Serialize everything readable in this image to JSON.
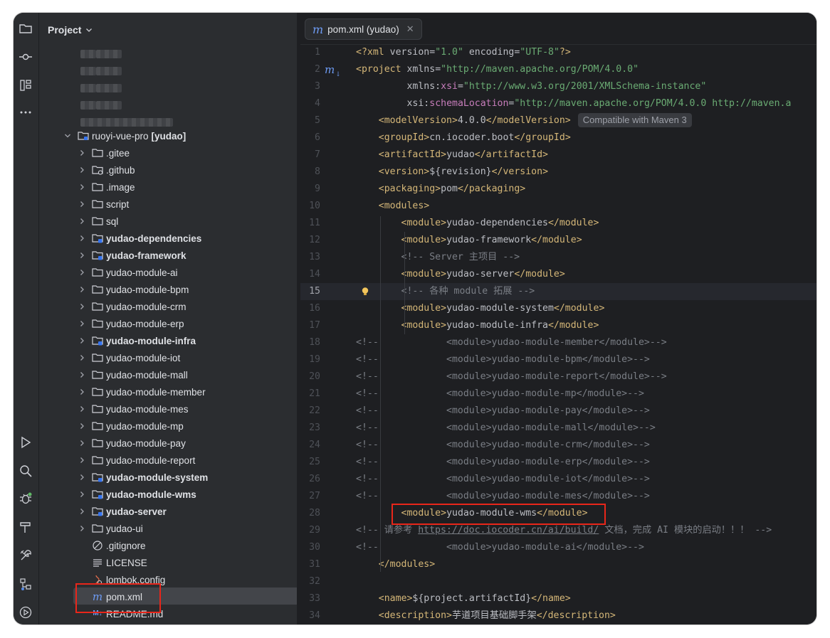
{
  "project_panel": {
    "title": "Project",
    "root": {
      "name": "ruoyi-vue-pro",
      "module": "[yudao]"
    },
    "children": [
      {
        "name": ".gitee",
        "type": "folder",
        "bold": false,
        "expandable": true
      },
      {
        "name": ".github",
        "type": "folder-special",
        "bold": false,
        "expandable": true
      },
      {
        "name": ".image",
        "type": "folder",
        "bold": false,
        "expandable": true
      },
      {
        "name": "script",
        "type": "folder",
        "bold": false,
        "expandable": true
      },
      {
        "name": "sql",
        "type": "folder",
        "bold": false,
        "expandable": true
      },
      {
        "name": "yudao-dependencies",
        "type": "module",
        "bold": true,
        "expandable": true
      },
      {
        "name": "yudao-framework",
        "type": "module",
        "bold": true,
        "expandable": true
      },
      {
        "name": "yudao-module-ai",
        "type": "folder",
        "bold": false,
        "expandable": true
      },
      {
        "name": "yudao-module-bpm",
        "type": "folder",
        "bold": false,
        "expandable": true
      },
      {
        "name": "yudao-module-crm",
        "type": "folder",
        "bold": false,
        "expandable": true
      },
      {
        "name": "yudao-module-erp",
        "type": "folder",
        "bold": false,
        "expandable": true
      },
      {
        "name": "yudao-module-infra",
        "type": "module",
        "bold": true,
        "expandable": true
      },
      {
        "name": "yudao-module-iot",
        "type": "folder",
        "bold": false,
        "expandable": true
      },
      {
        "name": "yudao-module-mall",
        "type": "folder",
        "bold": false,
        "expandable": true
      },
      {
        "name": "yudao-module-member",
        "type": "folder",
        "bold": false,
        "expandable": true
      },
      {
        "name": "yudao-module-mes",
        "type": "folder",
        "bold": false,
        "expandable": true
      },
      {
        "name": "yudao-module-mp",
        "type": "folder",
        "bold": false,
        "expandable": true
      },
      {
        "name": "yudao-module-pay",
        "type": "folder",
        "bold": false,
        "expandable": true
      },
      {
        "name": "yudao-module-report",
        "type": "folder",
        "bold": false,
        "expandable": true
      },
      {
        "name": "yudao-module-system",
        "type": "module",
        "bold": true,
        "expandable": true
      },
      {
        "name": "yudao-module-wms",
        "type": "module",
        "bold": true,
        "expandable": true
      },
      {
        "name": "yudao-server",
        "type": "module",
        "bold": true,
        "expandable": true
      },
      {
        "name": "yudao-ui",
        "type": "folder",
        "bold": false,
        "expandable": true
      },
      {
        "name": ".gitignore",
        "type": "gitignore",
        "bold": false,
        "expandable": false
      },
      {
        "name": "LICENSE",
        "type": "text",
        "bold": false,
        "expandable": false
      },
      {
        "name": "lombok.config",
        "type": "config",
        "bold": false,
        "expandable": false
      },
      {
        "name": "pom.xml",
        "type": "maven",
        "bold": false,
        "expandable": false,
        "selected": true
      },
      {
        "name": "README.md",
        "type": "markdown",
        "bold": false,
        "expandable": false
      }
    ]
  },
  "editor": {
    "tab": {
      "label": "pom.xml (yudao)",
      "icon": "maven-icon"
    },
    "current_line": 15,
    "inlay_hint": "Compatible with Maven 3",
    "lines": [
      {
        "n": "1",
        "t": "<?xml version=\"1.0\" encoding=\"UTF-8\"?>"
      },
      {
        "n": "2",
        "t": "<project xmlns=\"http://maven.apache.org/POM/4.0.0\""
      },
      {
        "n": "3",
        "t": "         xmlns:xsi=\"http://www.w3.org/2001/XMLSchema-instance\""
      },
      {
        "n": "4",
        "t": "         xsi:schemaLocation=\"http://maven.apache.org/POM/4.0.0 http://maven.a"
      },
      {
        "n": "5",
        "t": "    <modelVersion>4.0.0</modelVersion>"
      },
      {
        "n": "6",
        "t": "    <groupId>cn.iocoder.boot</groupId>"
      },
      {
        "n": "7",
        "t": "    <artifactId>yudao</artifactId>"
      },
      {
        "n": "8",
        "t": "    <version>${revision}</version>"
      },
      {
        "n": "9",
        "t": "    <packaging>pom</packaging>"
      },
      {
        "n": "10",
        "t": "    <modules>"
      },
      {
        "n": "11",
        "t": "        <module>yudao-dependencies</module>"
      },
      {
        "n": "12",
        "t": "        <module>yudao-framework</module>"
      },
      {
        "n": "13",
        "t": "        <!-- Server 主项目 -->"
      },
      {
        "n": "14",
        "t": "        <module>yudao-server</module>"
      },
      {
        "n": "15",
        "t": "        <!-- 各种 module 拓展 -->"
      },
      {
        "n": "16",
        "t": "        <module>yudao-module-system</module>"
      },
      {
        "n": "17",
        "t": "        <module>yudao-module-infra</module>"
      },
      {
        "n": "18",
        "t": "<!--            <module>yudao-module-member</module>-->"
      },
      {
        "n": "19",
        "t": "<!--            <module>yudao-module-bpm</module>-->"
      },
      {
        "n": "20",
        "t": "<!--            <module>yudao-module-report</module>-->"
      },
      {
        "n": "21",
        "t": "<!--            <module>yudao-module-mp</module>-->"
      },
      {
        "n": "22",
        "t": "<!--            <module>yudao-module-pay</module>-->"
      },
      {
        "n": "23",
        "t": "<!--            <module>yudao-module-mall</module>-->"
      },
      {
        "n": "24",
        "t": "<!--            <module>yudao-module-crm</module>-->"
      },
      {
        "n": "25",
        "t": "<!--            <module>yudao-module-erp</module>-->"
      },
      {
        "n": "26",
        "t": "<!--            <module>yudao-module-iot</module>-->"
      },
      {
        "n": "27",
        "t": "<!--            <module>yudao-module-mes</module>-->"
      },
      {
        "n": "28",
        "t": "        <module>yudao-module-wms</module>"
      },
      {
        "n": "29",
        "t": "<!-- 请参考 https://doc.iocoder.cn/ai/build/ 文档，完成 AI 模块的启动！！！ -->"
      },
      {
        "n": "30",
        "t": "<!--            <module>yudao-module-ai</module>-->"
      },
      {
        "n": "31",
        "t": "    </modules>"
      },
      {
        "n": "32",
        "t": ""
      },
      {
        "n": "33",
        "t": "    <name>${project.artifactId}</name>"
      },
      {
        "n": "34",
        "t": "    <description>芋道项目基础脚手架</description>"
      }
    ]
  },
  "colors": {
    "tag": "#d5b778",
    "string": "#6aab73",
    "comment": "#7a7e85",
    "highlight": "#e8261a"
  }
}
